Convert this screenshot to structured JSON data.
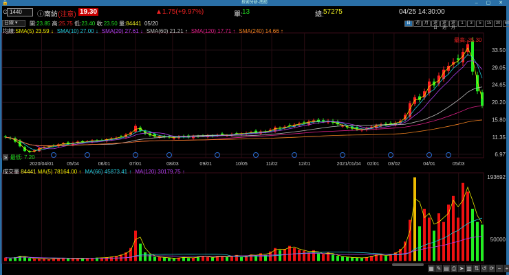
{
  "window": {
    "title": "技術分析-南紡",
    "controls": "– ▢ ✕"
  },
  "header": {
    "code": "1440",
    "name": "南紡",
    "alert": "(注意)",
    "price": "19.30",
    "change": "▲1.75(+9.97%)",
    "unit_label": "單:",
    "unit_value": "13",
    "total_label": "總:",
    "total_value": "57275",
    "datetime": "04/25 14:30:00"
  },
  "ohlc": {
    "period_select": "日線",
    "open_label": "開:",
    "open": "23.85",
    "high_label": "高:",
    "high": "25.75",
    "low_label": "低:",
    "low": "23.40",
    "close_label": "收:",
    "close": "23.50",
    "vol_label": "量:",
    "vol": "84441",
    "date": "05/20"
  },
  "periods": [
    "日",
    "週",
    "月",
    "還日",
    "還週",
    "還月",
    "1",
    "3",
    "5",
    "15",
    "30",
    "60"
  ],
  "ma_line": {
    "label": "均線:",
    "items": [
      {
        "text": "SMA(5) 23.59 ↓",
        "color": "#e6e600"
      },
      {
        "text": "SMA(10) 27.00 ↓",
        "color": "#22c8d8"
      },
      {
        "text": "SMA(20) 27.61 ↓",
        "color": "#b040f0"
      },
      {
        "text": "SMA(60) 21.21 ↑",
        "color": "#bbbbbb"
      },
      {
        "text": "SMA(120) 17.71 ↑",
        "color": "#e0208a"
      },
      {
        "text": "SMA(240) 14.66 ↑",
        "color": "#f08020"
      }
    ]
  },
  "vol_line": {
    "label": "成交量",
    "value": "84441",
    "items": [
      {
        "text": "MA(5) 78164.00 ↑",
        "color": "#e6e600"
      },
      {
        "text": "MA(66) 45873.41 ↑",
        "color": "#22c8d8"
      },
      {
        "text": "MA(120) 30179.75 ↑",
        "color": "#b040f0"
      }
    ]
  },
  "annotations": {
    "high": "最高: 35.30",
    "low": "最低: 7.20"
  },
  "toolbar": [
    "▦",
    "✎",
    "▤",
    "⎙",
    "➤",
    "▥",
    "⇅",
    "↺",
    "⟳",
    "−",
    "+"
  ],
  "chart_data": {
    "type": "candlestick",
    "price_axis": {
      "ticks": [
        33.5,
        29.05,
        24.65,
        20.2,
        15.8,
        11.35,
        6.97
      ],
      "range": [
        6.97,
        33.5
      ]
    },
    "volume_axis": {
      "ticks": [
        193692,
        50000
      ],
      "range": [
        0,
        193692
      ]
    },
    "x_ticks": [
      {
        "label": "2020/04/01",
        "i": 7.5
      },
      {
        "label": "05/04",
        "i": 14
      },
      {
        "label": "06/01",
        "i": 20.5
      },
      {
        "label": "07/01",
        "i": 27
      },
      {
        "label": "08/03",
        "i": 34.7
      },
      {
        "label": "09/01",
        "i": 41.6
      },
      {
        "label": "10/05",
        "i": 49
      },
      {
        "label": "11/02",
        "i": 55.3
      },
      {
        "label": "12/01",
        "i": 62.1
      },
      {
        "label": "2021/01/04",
        "i": 71.3
      },
      {
        "label": "02/01",
        "i": 76.4
      },
      {
        "label": "03/02",
        "i": 80.7
      },
      {
        "label": "04/01",
        "i": 88
      },
      {
        "label": "05/03",
        "i": 94.1
      }
    ],
    "closes": [
      11.3,
      11.0,
      10.2,
      9.0,
      7.8,
      7.5,
      8.0,
      8.6,
      8.8,
      9.0,
      9.2,
      9.5,
      9.8,
      9.6,
      9.9,
      10.2,
      10.0,
      10.3,
      10.5,
      10.4,
      10.6,
      10.8,
      11.0,
      11.2,
      11.5,
      12.0,
      12.5,
      14.2,
      13.0,
      12.2,
      11.8,
      11.5,
      11.6,
      11.4,
      11.3,
      11.2,
      11.5,
      11.4,
      11.3,
      11.6,
      11.5,
      11.7,
      11.8,
      11.6,
      11.9,
      12.0,
      11.8,
      12.1,
      12.3,
      12.2,
      12.4,
      12.6,
      12.5,
      12.8,
      12.7,
      13.2,
      13.8,
      13.5,
      14.0,
      14.3,
      14.5,
      14.8,
      15.0,
      15.3,
      15.6,
      15.2,
      15.4,
      15.5,
      15.0,
      14.6,
      14.2,
      13.8,
      13.5,
      13.3,
      13.2,
      13.6,
      14.0,
      14.3,
      14.6,
      14.5,
      14.8,
      15.0,
      15.5,
      17.0,
      20.0,
      21.5,
      20.8,
      23.0,
      25.5,
      24.5,
      27.0,
      28.5,
      29.5,
      30.5,
      31.0,
      33.0,
      35.0,
      28.0,
      23.0,
      19.3
    ],
    "volumes": [
      8,
      6,
      9,
      12,
      10,
      7,
      5,
      6,
      5,
      4,
      6,
      5,
      7,
      6,
      5,
      6,
      5,
      7,
      6,
      8,
      7,
      9,
      10,
      12,
      15,
      20,
      30,
      70,
      40,
      20,
      15,
      10,
      9,
      8,
      7,
      6,
      8,
      9,
      7,
      8,
      10,
      12,
      9,
      8,
      11,
      10,
      9,
      12,
      14,
      10,
      13,
      15,
      12,
      18,
      14,
      22,
      30,
      25,
      28,
      35,
      30,
      26,
      24,
      20,
      25,
      18,
      16,
      20,
      15,
      12,
      10,
      9,
      8,
      8,
      7,
      9,
      12,
      15,
      14,
      12,
      16,
      20,
      28,
      45,
      95,
      193,
      80,
      120,
      100,
      70,
      110,
      90,
      130,
      150,
      100,
      180,
      160,
      120,
      90,
      84
    ]
  }
}
